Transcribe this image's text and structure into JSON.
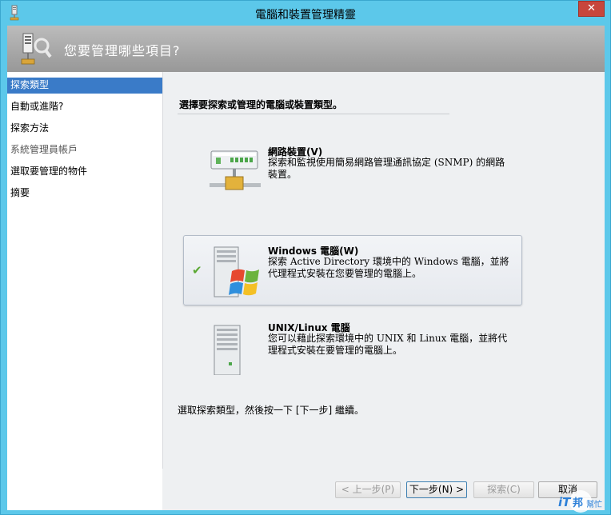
{
  "window": {
    "title": "電腦和裝置管理精靈",
    "close_label": "✕"
  },
  "banner": {
    "title": "您要管理哪些項目?"
  },
  "sidebar": {
    "items": [
      {
        "label": "探索類型"
      },
      {
        "label": "自動或進階?"
      },
      {
        "label": "探索方法"
      },
      {
        "label": "系統管理員帳戶"
      },
      {
        "label": "選取要管理的物件"
      },
      {
        "label": "摘要"
      }
    ]
  },
  "content": {
    "heading": "選擇要探索或管理的電腦或裝置類型。",
    "options": [
      {
        "title": "網路裝置(V)",
        "description": "探索和監視使用簡易網路管理通訊協定 (SNMP) 的網路裝置。"
      },
      {
        "title": "Windows 電腦(W)",
        "description": "探索 Active Directory 環境中的 Windows 電腦，並將代理程式安裝在您要管理的電腦上。",
        "check": "✔"
      },
      {
        "title": "UNIX/Linux 電腦",
        "description": "您可以藉此探索環境中的 UNIX 和 Linux 電腦，並將代理程式安裝在要管理的電腦上。"
      }
    ],
    "instruction": "選取探索類型，然後按一下 [下一步] 繼續。"
  },
  "buttons": {
    "back": "< 上一步(P)",
    "next": "下一步(N) >",
    "discover": "探索(C)",
    "cancel": "取消"
  },
  "watermark": {
    "text1": "iT",
    "text2": "邦",
    "text3": "幫忙"
  },
  "colors": {
    "accent": "#3a7bc8",
    "titlebar": "#5cc8ea",
    "close": "#c7463c",
    "check": "#5aa832"
  }
}
